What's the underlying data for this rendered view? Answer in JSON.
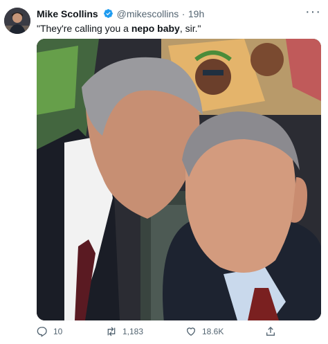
{
  "tweet": {
    "author": {
      "name": "Mike Scollins",
      "handle": "@mikescollins",
      "avatar_icon": "person-avatar"
    },
    "separator": "·",
    "time": "19h",
    "more_label": "···",
    "text": {
      "before": "\"They're calling you a ",
      "bold": "nepo baby",
      "after": ", sir.\""
    },
    "stats": {
      "replies": "10",
      "retweets": "1,183",
      "likes": "18.6K"
    },
    "icons": {
      "reply": "reply-icon",
      "retweet": "retweet-icon",
      "like": "heart-icon",
      "share": "share-icon",
      "verified": "verified-badge-icon"
    },
    "colors": {
      "text": "#0f1419",
      "secondary": "#536471",
      "verified": "#1d9bf0"
    }
  }
}
